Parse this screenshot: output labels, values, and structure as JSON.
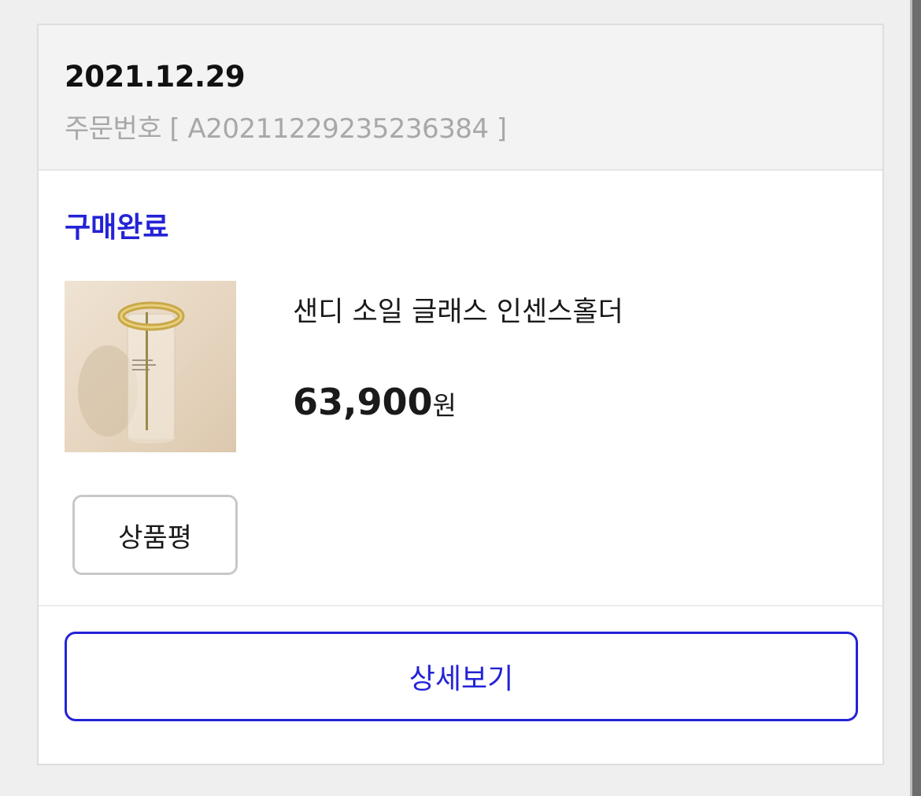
{
  "order": {
    "date": "2021.12.29",
    "number_label": "주문번호 [ A20211229235236384 ]",
    "status": "구매완료"
  },
  "product": {
    "name": "샌디 소일 글래스 인센스홀더",
    "price_amount": "63,900",
    "price_unit": "원",
    "thumbnail_icon": "incense-holder-photo"
  },
  "actions": {
    "review_label": "상품평",
    "detail_label": "상세보기"
  },
  "colors": {
    "accent": "#2323d6",
    "header_bg": "#f3f3f3",
    "page_bg": "#efefef"
  }
}
